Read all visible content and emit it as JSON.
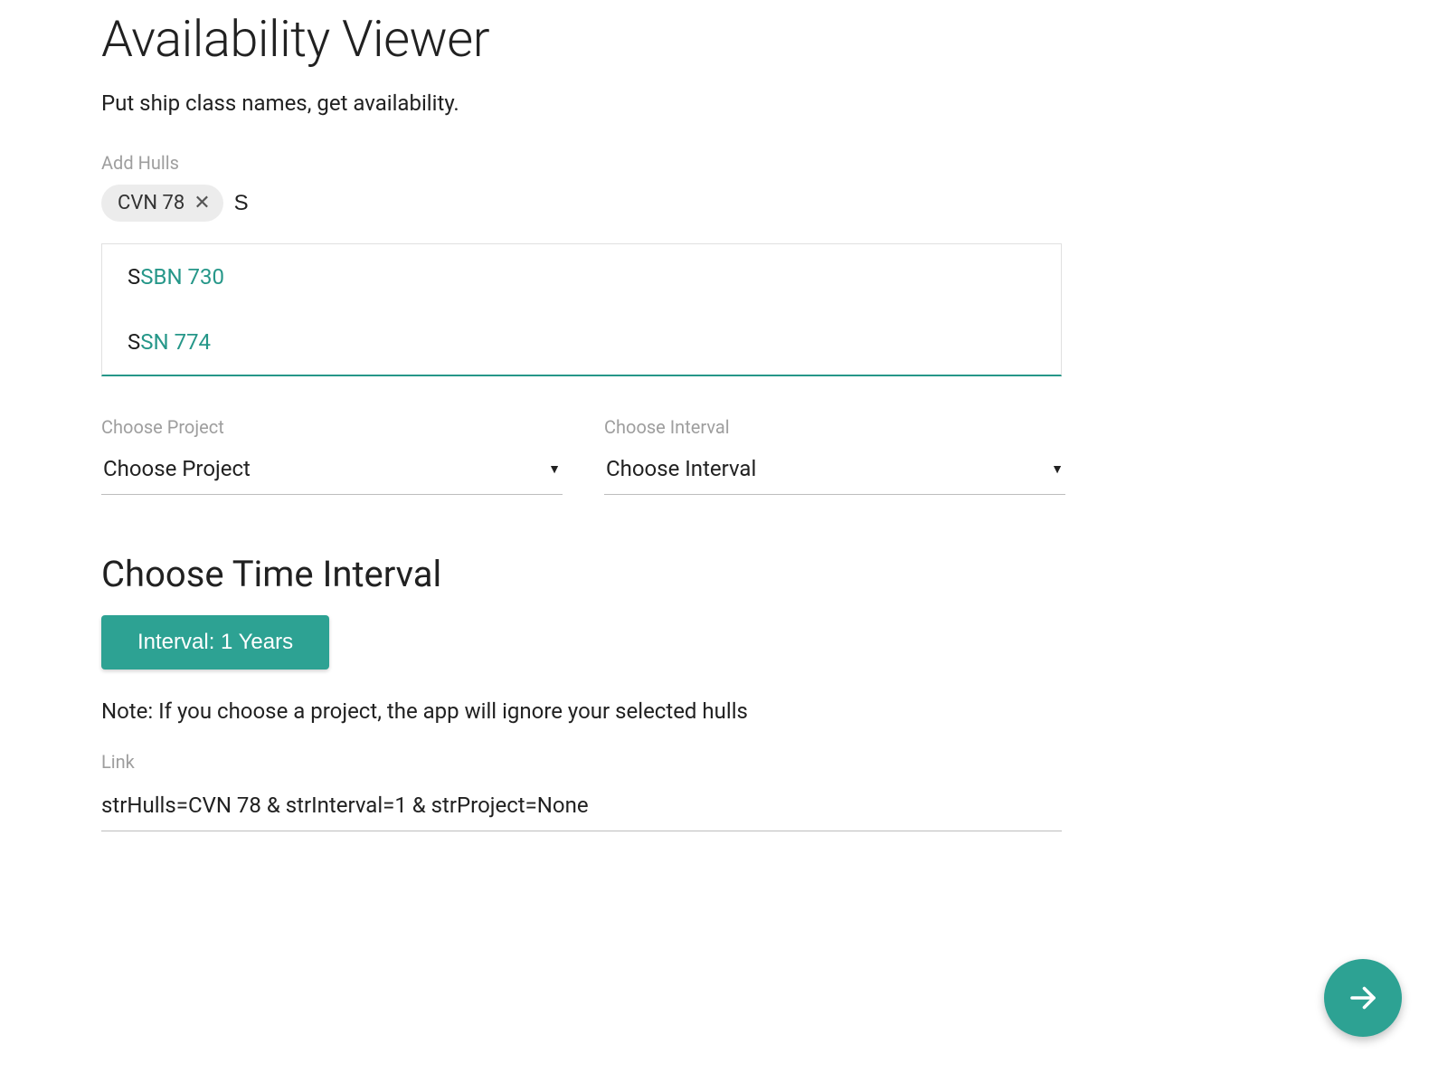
{
  "header": {
    "title": "Availability Viewer",
    "subtitle": "Put ship class names, get availability."
  },
  "hulls": {
    "label": "Add Hulls",
    "chips": [
      {
        "label": "CVN 78"
      }
    ],
    "input_value": "S",
    "suggestions": [
      {
        "prefix": "S",
        "rest": "SBN 730"
      },
      {
        "prefix": "S",
        "rest": "SN 774"
      }
    ]
  },
  "project_select": {
    "label": "Choose Project",
    "value": "Choose Project"
  },
  "interval_select": {
    "label": "Choose Interval",
    "value": "Choose Interval"
  },
  "time_interval": {
    "heading": "Choose Time Interval",
    "button_label": "Interval: 1 Years"
  },
  "note": "Note: If you choose a project, the app will ignore your selected hulls",
  "link": {
    "label": "Link",
    "value": "strHulls=CVN 78 & strInterval=1 & strProject=None"
  },
  "colors": {
    "accent": "#2da293"
  }
}
